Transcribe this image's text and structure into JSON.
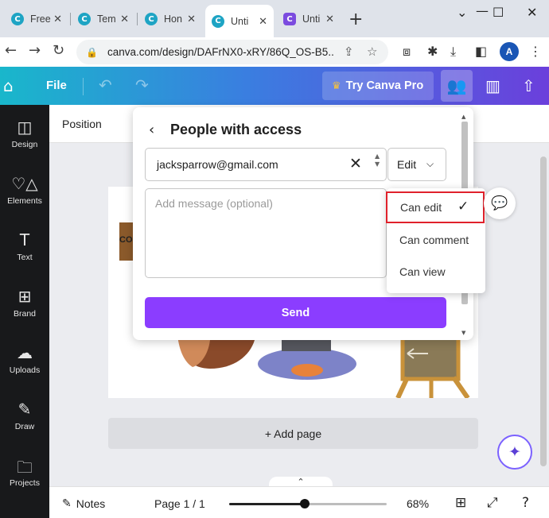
{
  "browser": {
    "tabs": [
      {
        "label": "Free",
        "icon": "canva-icon"
      },
      {
        "label": "Tem",
        "icon": "canva-icon"
      },
      {
        "label": "Hon",
        "icon": "canva-icon"
      },
      {
        "label": "Unti",
        "icon": "canva-icon"
      },
      {
        "label": "Unti",
        "icon": "canva-icon"
      }
    ],
    "new_tab": "+",
    "url": "canva.com/design/DAFrNX0-xRY/86Q_OS-B5...",
    "profile_initial": "A"
  },
  "canva_header": {
    "file_label": "File",
    "try_pro_label": "Try Canva Pro"
  },
  "sidebar": {
    "items": [
      {
        "label": "Design",
        "icon": "layout-icon"
      },
      {
        "label": "Elements",
        "icon": "shapes-icon"
      },
      {
        "label": "Text",
        "icon": "text-icon"
      },
      {
        "label": "Brand",
        "icon": "brand-icon"
      },
      {
        "label": "Uploads",
        "icon": "upload-icon"
      },
      {
        "label": "Draw",
        "icon": "draw-icon"
      },
      {
        "label": "Projects",
        "icon": "folder-icon"
      }
    ]
  },
  "toolbar": {
    "position_label": "Position"
  },
  "page_art": {
    "box_text": "CO"
  },
  "share_panel": {
    "title": "People with access",
    "email_value": "jacksparrow@gmail.com",
    "permission_value": "Edit",
    "message_placeholder": "Add message (optional)",
    "send_label": "Send"
  },
  "permission_menu": {
    "options": [
      "Can edit",
      "Can comment",
      "Can view"
    ],
    "selected": "Can edit"
  },
  "canvas": {
    "add_page_label": "+ Add page"
  },
  "bottom_bar": {
    "notes_label": "Notes",
    "page_indicator": "Page 1 / 1",
    "zoom_percent": "68%",
    "zoom_slider_level": 0.48
  },
  "colors": {
    "accent": "#8b3dff",
    "header_gradient_start": "#19b7cb",
    "header_gradient_end": "#6b3fdc",
    "highlight": "#e0212b"
  }
}
